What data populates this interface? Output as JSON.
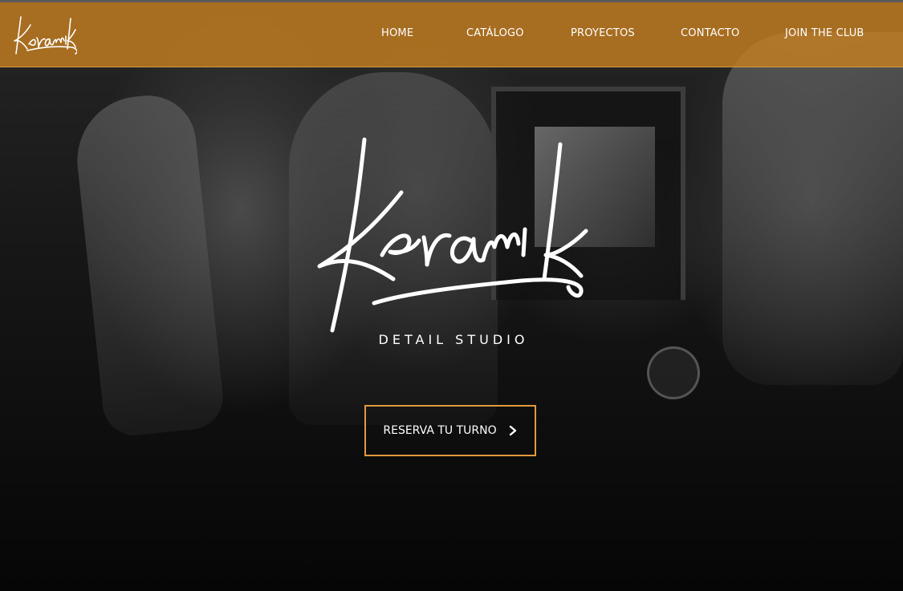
{
  "brand": {
    "logo_text": "Keramik",
    "tagline": "DETAIL STUDIO",
    "accent_color": "#c47e20",
    "button_border_color": "#e39a3a"
  },
  "nav": {
    "items": [
      {
        "label": "HOME"
      },
      {
        "label": "CATÁLOGO"
      },
      {
        "label": "PROYECTOS"
      },
      {
        "label": "CONTACTO"
      },
      {
        "label": "JOIN THE CLUB"
      }
    ]
  },
  "hero": {
    "cta_label": "RESERVA TU TURNO",
    "cta_icon": "chevron-right-icon"
  }
}
